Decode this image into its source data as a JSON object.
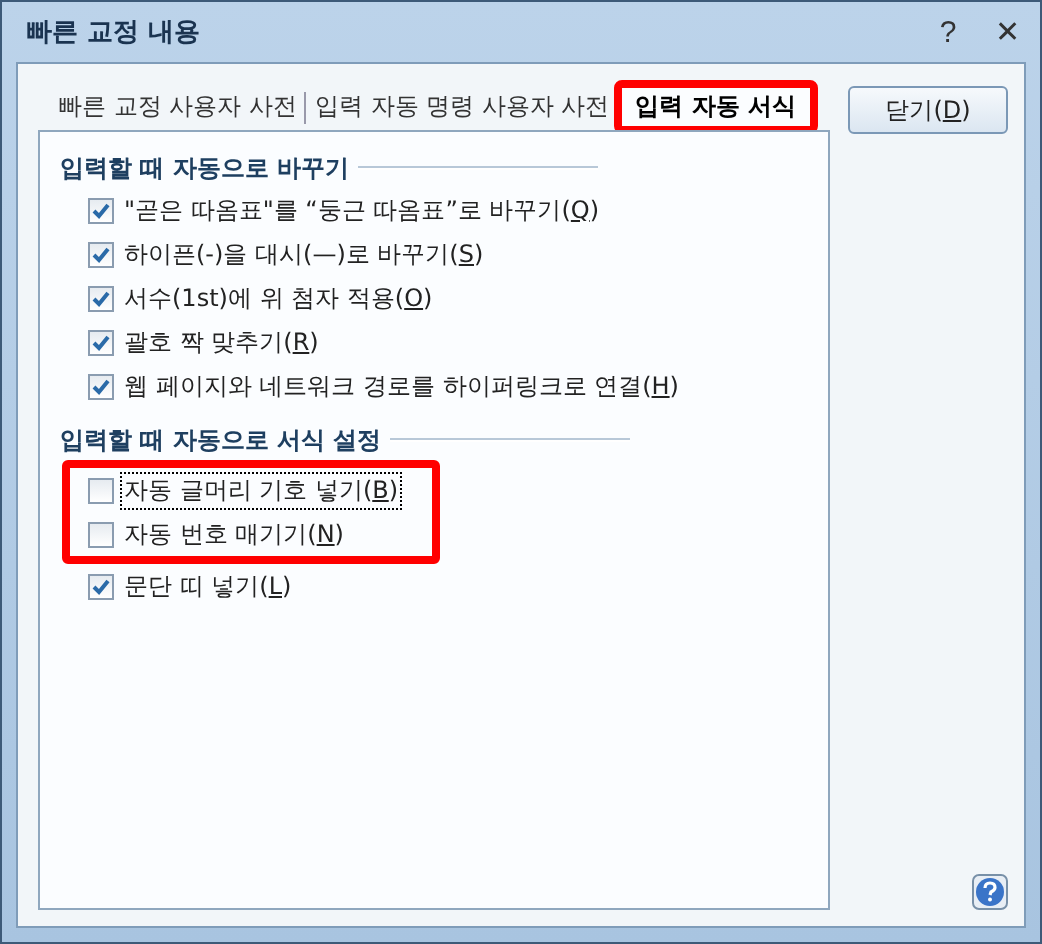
{
  "window": {
    "title": "빠른 교정 내용",
    "help_glyph": "?",
    "close_glyph": "✕"
  },
  "tabs": [
    {
      "label": "빠른 교정 사용자 사전",
      "selected": false,
      "highlighted": false
    },
    {
      "label": "입력 자동 명령 사용자 사전",
      "selected": false,
      "highlighted": false
    },
    {
      "label": "입력 자동 서식",
      "selected": true,
      "highlighted": true
    }
  ],
  "close_button": "닫기(D)",
  "groups": [
    {
      "title": "입력할 때 자동으로 바꾸기",
      "items": [
        {
          "label": "\"곧은 따옴표\"를 “둥근 따옴표”로 바꾸기(Q)",
          "checked": true,
          "highlighted": false,
          "focused": false
        },
        {
          "label": "하이픈(-)을 대시(—)로 바꾸기(S)",
          "checked": true,
          "highlighted": false,
          "focused": false
        },
        {
          "label": "서수(1st)에 위 첨자 적용(O)",
          "checked": true,
          "highlighted": false,
          "focused": false
        },
        {
          "label": "괄호 짝 맞추기(R)",
          "checked": true,
          "highlighted": false,
          "focused": false
        },
        {
          "label": "웹 페이지와 네트워크 경로를 하이퍼링크로 연결(H)",
          "checked": true,
          "highlighted": false,
          "focused": false
        }
      ]
    },
    {
      "title": "입력할 때 자동으로 서식 설정",
      "items": [
        {
          "label": "자동 글머리 기호 넣기(B)",
          "checked": false,
          "highlighted": true,
          "focused": true
        },
        {
          "label": "자동 번호 매기기(N)",
          "checked": false,
          "highlighted": true,
          "focused": false
        },
        {
          "label": "문단 띠 넣기(L)",
          "checked": true,
          "highlighted": false,
          "focused": false
        }
      ]
    }
  ]
}
